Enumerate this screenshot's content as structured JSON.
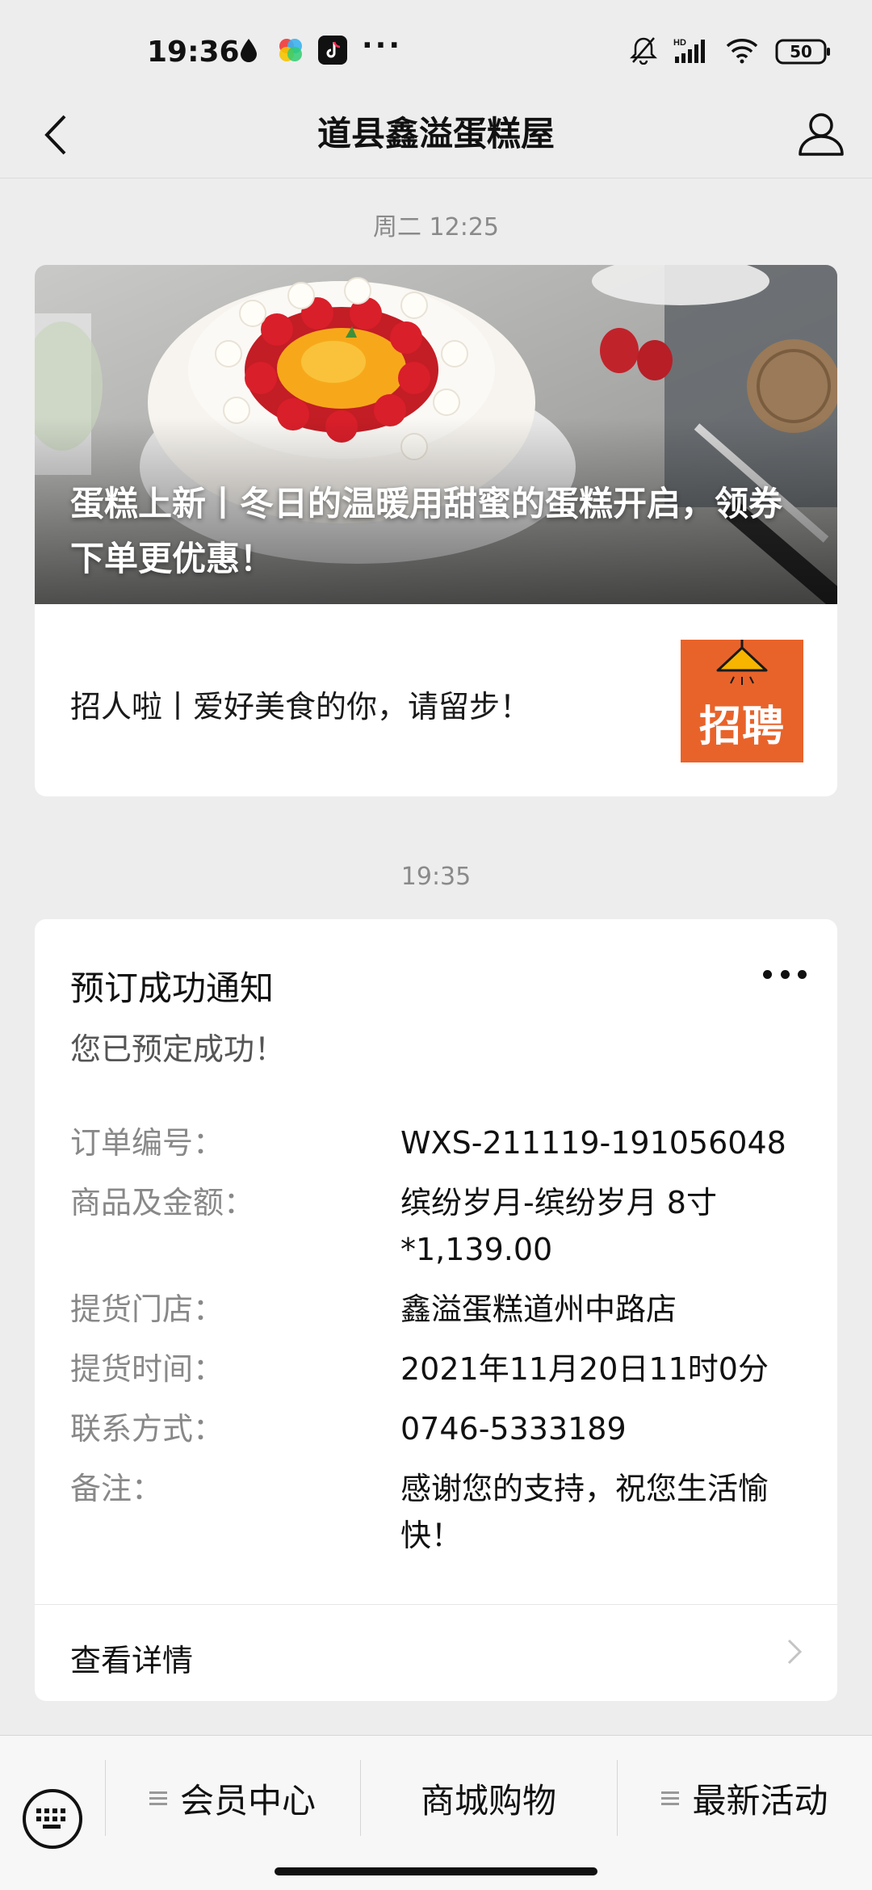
{
  "status_bar": {
    "time": "19:36",
    "more": "···",
    "battery": "50",
    "network_label": "HD"
  },
  "nav": {
    "title": "道县鑫溢蛋糕屋"
  },
  "timestamps": {
    "first": "周二 12:25",
    "second": "19:35"
  },
  "article": {
    "headline": "蛋糕上新丨冬日的温暖用甜蜜的蛋糕开启，领券下单更优惠！",
    "sub_title": "招人啦丨爱好美食的你，请留步！",
    "thumb_text": "招聘"
  },
  "notice": {
    "title": "预订成功通知",
    "subtitle": "您已预定成功！",
    "fields": [
      {
        "label": "订单编号：",
        "value": "WXS-211119-191056048"
      },
      {
        "label": "商品及金额：",
        "value": "缤纷岁月-缤纷岁月 8寸 *1,139.00"
      },
      {
        "label": "提货门店：",
        "value": "鑫溢蛋糕道州中路店"
      },
      {
        "label": "提货时间：",
        "value": "2021年11月20日11时0分"
      },
      {
        "label": "联系方式：",
        "value": "0746-5333189"
      },
      {
        "label": "备注：",
        "value": "感谢您的支持，祝您生活愉快！"
      }
    ],
    "link_label": "查看详情"
  },
  "bottom_menu": {
    "items": [
      "会员中心",
      "商城购物",
      "最新活动"
    ]
  },
  "colors": {
    "background": "#ededed",
    "card": "#ffffff",
    "thumb_orange": "#e8632a"
  }
}
